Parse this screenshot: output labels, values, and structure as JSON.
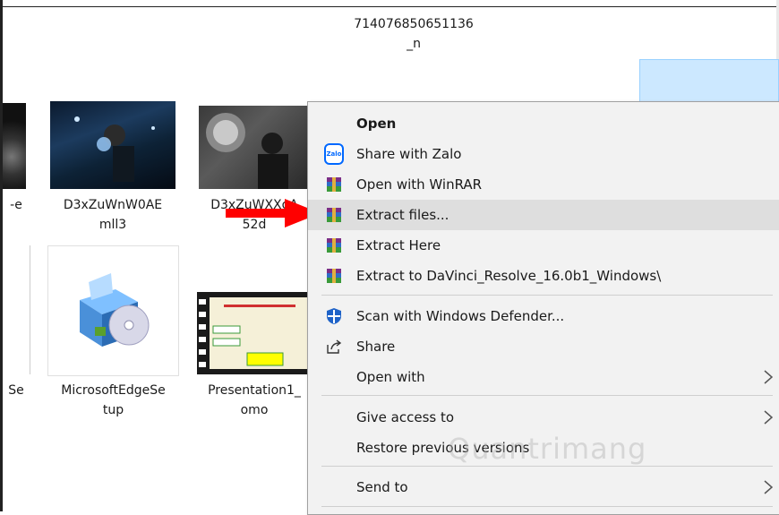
{
  "top_labels": {
    "line1": "714076850651136",
    "line2": "_n"
  },
  "files": [
    {
      "caption": "-e"
    },
    {
      "caption": "D3xZuWnW0AE\nmll3"
    },
    {
      "caption": "D3xZuWXXoA\n52d"
    },
    {
      "caption": "Se"
    },
    {
      "caption": "MicrosoftEdgeSe\ntup"
    },
    {
      "caption": "Presentation1_\nomo"
    }
  ],
  "context_menu": {
    "items": [
      {
        "label": "Open",
        "icon": "none"
      },
      {
        "label": "Share with Zalo",
        "icon": "zalo-icon",
        "icon_text": "Zalo"
      },
      {
        "label": "Open with WinRAR",
        "icon": "winrar-icon"
      },
      {
        "label": "Extract files...",
        "icon": "winrar-icon"
      },
      {
        "label": "Extract Here",
        "icon": "winrar-icon"
      },
      {
        "label": "Extract to DaVinci_Resolve_16.0b1_Windows\\",
        "icon": "winrar-icon"
      },
      {
        "label": "Scan with Windows Defender...",
        "icon": "defender-shield-icon"
      },
      {
        "label": "Share",
        "icon": "share-icon"
      },
      {
        "label": "Open with",
        "icon": "none",
        "submenu": true
      },
      {
        "label": "Give access to",
        "icon": "none",
        "submenu": true
      },
      {
        "label": "Restore previous versions",
        "icon": "none"
      },
      {
        "label": "Send to",
        "icon": "none",
        "submenu": true
      }
    ]
  },
  "watermark": {
    "text": "Quantrimang"
  },
  "colors": {
    "highlight": "#dedede",
    "menu_bg": "#f2f2f2",
    "arrow": "#ff0000",
    "zalo": "#0068ff"
  }
}
